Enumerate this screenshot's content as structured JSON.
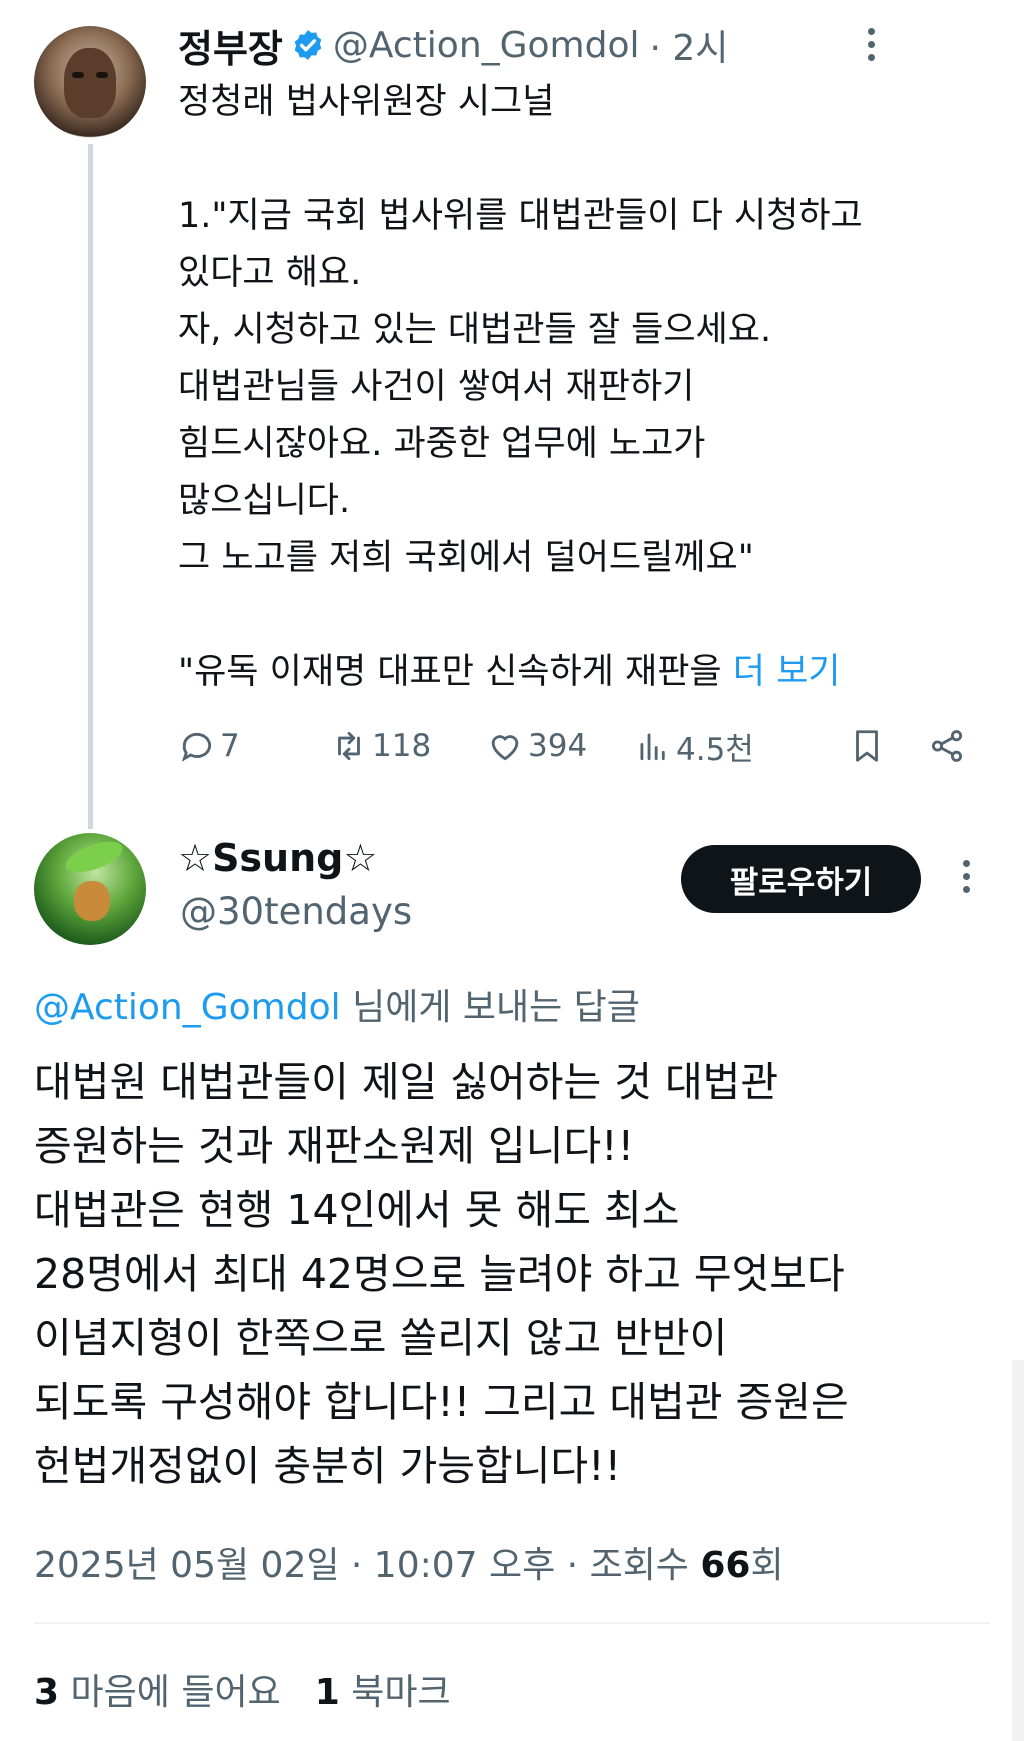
{
  "tweet1": {
    "author_name": "정부장",
    "handle": "@Action_Gomdol",
    "time": "· 2시",
    "lines": [
      "정청래 법사위원장 시그널",
      "",
      "1.\"지금 국회 법사위를 대법관들이 다 시청하고",
      "있다고 해요.",
      "자, 시청하고 있는 대법관들 잘 들으세요.",
      "대법관님들 사건이 쌓여서 재판하기",
      "힘드시잖아요. 과중한 업무에 노고가",
      "많으십니다.",
      "그 노고를 저희 국회에서 덜어드릴께요\"",
      ""
    ],
    "last_line": "\"유독 이재명 대표만 신속하게 재판을",
    "more_label": "더 보기",
    "actions": {
      "replies": "7",
      "retweets": "118",
      "likes": "394",
      "views": "4.5천"
    }
  },
  "tweet2": {
    "author_name": "☆Ssung☆",
    "handle": "@30tendays",
    "follow_label": "팔로우하기",
    "replying_to": "@Action_Gomdol",
    "replying_suffix": "님에게 보내는 답글",
    "lines": [
      "대법원 대법관들이 제일 싫어하는 것 대법관",
      "증원하는 것과 재판소원제 입니다!!",
      "대법관은 현행 14인에서 못 해도 최소",
      "28명에서 최대 42명으로 늘려야 하고 무엇보다",
      "이념지형이 한쪽으로 쏠리지 않고 반반이",
      "되도록 구성해야 합니다!! 그리고 대법관 증원은",
      "헌법개정없이 충분히 가능합니다!!"
    ],
    "meta_prefix": "2025년 05월 02일 · 10:07 오후 · 조회수 ",
    "view_count": "66",
    "meta_suffix": "회",
    "likes_count": "3",
    "likes_label": "마음에 들어요",
    "bookmarks_count": "1",
    "bookmarks_label": "북마크"
  },
  "colors": {
    "link": "#1d9bf0",
    "secondary_text": "#536471",
    "primary_text": "#0f1419",
    "follow_button": "#0f1419"
  },
  "icons": [
    "verified-badge-icon",
    "reply-icon",
    "retweet-icon",
    "like-icon",
    "views-icon",
    "bookmark-icon",
    "share-icon",
    "more-icon"
  ]
}
